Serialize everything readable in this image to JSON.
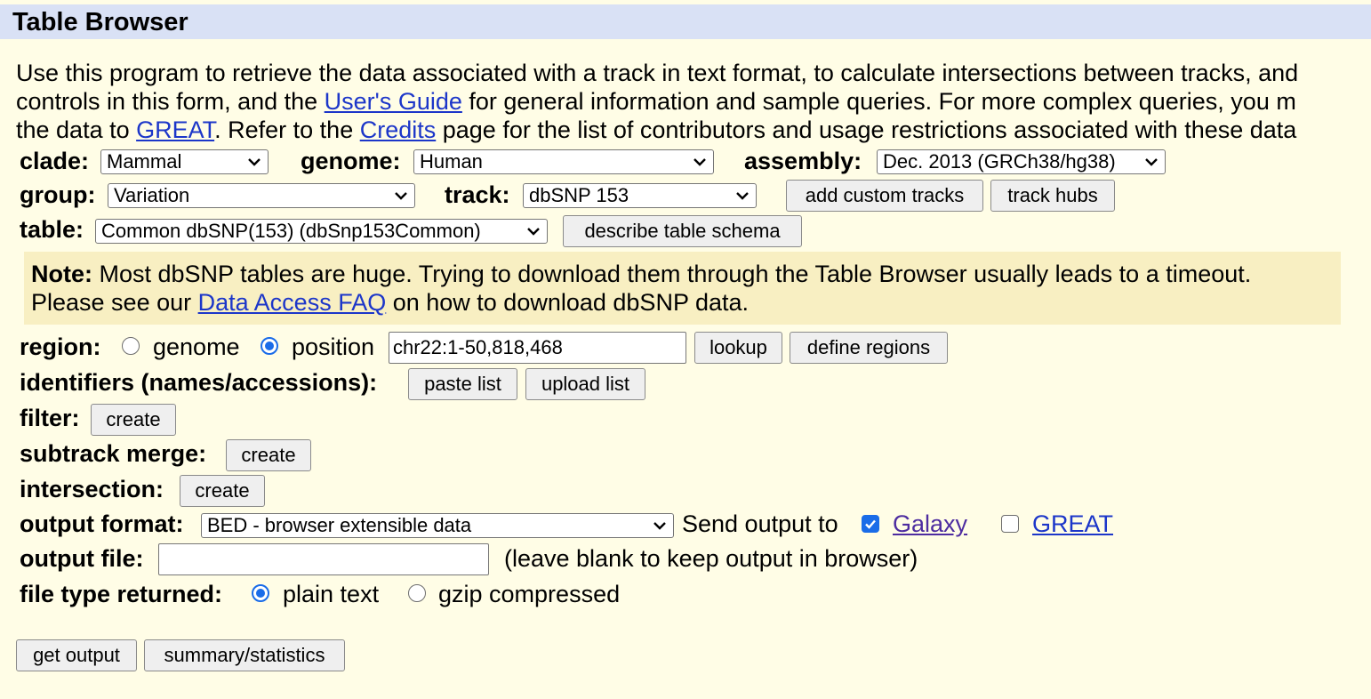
{
  "page": {
    "title": "Table Browser",
    "intro": {
      "line1": "Use this program to retrieve the data associated with a track in text format, to calculate intersections between tracks, and",
      "line2_a": "controls in this form, and the ",
      "line2_link": "User's Guide",
      "line2_b": " for general information and sample queries. For more complex queries, you m",
      "line3_a": "the data to ",
      "line3_link1": "GREAT",
      "line3_b": ". Refer to the ",
      "line3_link2": "Credits",
      "line3_c": " page for the list of contributors and usage restrictions associated with these data"
    }
  },
  "form": {
    "clade": {
      "label": "clade:",
      "value": "Mammal"
    },
    "genome": {
      "label": "genome:",
      "value": "Human"
    },
    "assembly": {
      "label": "assembly:",
      "value": "Dec. 2013 (GRCh38/hg38)"
    },
    "group": {
      "label": "group:",
      "value": "Variation"
    },
    "track": {
      "label": "track:",
      "value": "dbSNP 153"
    },
    "add_custom_tracks": "add custom tracks",
    "track_hubs": "track hubs",
    "table": {
      "label": "table:",
      "value": "Common dbSNP(153) (dbSnp153Common)"
    },
    "describe_schema": "describe table schema",
    "note": {
      "bold": "Note:",
      "text1": " Most dbSNP tables are huge. Trying to download them through the Table Browser usually leads to a timeout.",
      "text2a": "Please see our ",
      "link": "Data Access FAQ",
      "text2b": " on how to download dbSNP data."
    },
    "region": {
      "label": "region:",
      "opt_genome": "genome",
      "opt_position": "position",
      "selected": "position",
      "position_value": "chr22:1-50,818,468",
      "lookup": "lookup",
      "define_regions": "define regions"
    },
    "identifiers": {
      "label": "identifiers (names/accessions):",
      "paste_list": "paste list",
      "upload_list": "upload list"
    },
    "filter": {
      "label": "filter:",
      "button": "create"
    },
    "subtrack_merge": {
      "label": "subtrack merge:",
      "button": "create"
    },
    "intersection": {
      "label": "intersection:",
      "button": "create"
    },
    "output_format": {
      "label": "output format:",
      "value": "BED - browser extensible data",
      "send_to": "Send output to",
      "galaxy": "Galaxy",
      "galaxy_checked": true,
      "great": "GREAT",
      "great_checked": false
    },
    "output_file": {
      "label": "output file:",
      "value": "",
      "hint": "(leave blank to keep output in browser)"
    },
    "file_type": {
      "label": "file type returned:",
      "opt_plain": "plain text",
      "opt_gzip": "gzip compressed",
      "selected": "plain text"
    },
    "get_output": "get output",
    "summary_statistics": "summary/statistics"
  },
  "colors": {
    "background": "#fffde6",
    "title_bar": "#d9e1f5",
    "note_bg": "#f8efc2",
    "link": "#1c36c9",
    "accent": "#1a6ce8"
  }
}
